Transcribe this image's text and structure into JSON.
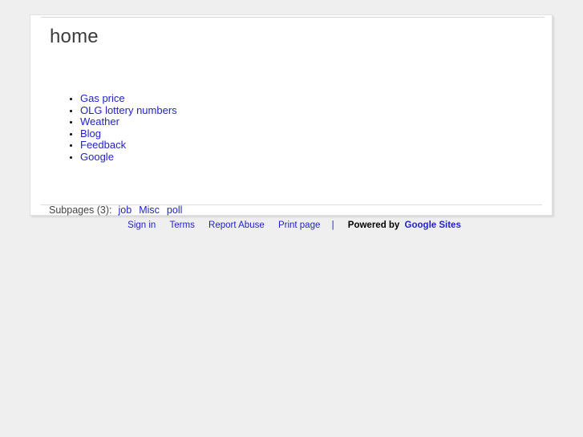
{
  "background_color": "#efefef",
  "container": {
    "background_color": "#ffffff",
    "border_color": "#e2e2e2"
  },
  "page": {
    "title": "home"
  },
  "link_color": "#2222cc",
  "title_color": "#3c3c3c",
  "content_links": [
    {
      "label": "Gas price"
    },
    {
      "label": "OLG lottery numbers"
    },
    {
      "label": "Weather"
    },
    {
      "label": "Blog"
    },
    {
      "label": "Feedback"
    },
    {
      "label": "Google"
    }
  ],
  "subpages": {
    "label": "Subpages (3):",
    "items": [
      {
        "label": "job"
      },
      {
        "label": "Misc"
      },
      {
        "label": "poll"
      }
    ]
  },
  "footer": {
    "links": [
      {
        "label": "Sign in"
      },
      {
        "label": "Terms"
      },
      {
        "label": "Report Abuse"
      },
      {
        "label": "Print page"
      }
    ],
    "separator": "|",
    "powered_by_label": "Powered by",
    "brand_label": "Google Sites"
  }
}
